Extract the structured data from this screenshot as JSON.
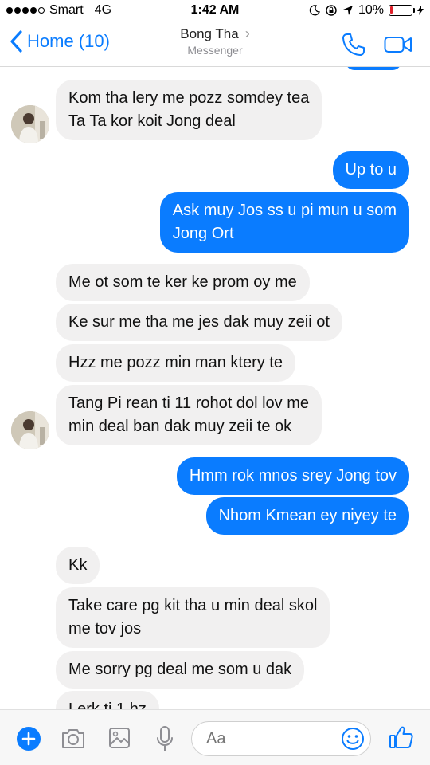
{
  "status_bar": {
    "carrier": "Smart",
    "network": "4G",
    "time": "1:42 AM",
    "battery": "10%",
    "battery_level": 0.1
  },
  "header": {
    "back_label": "Home (10)",
    "contact_name": "Bong Tha",
    "subtitle": "Messenger"
  },
  "messages": [
    {
      "dir": "in",
      "lines": [
        "Kom tha lery me pozz somdey tea",
        "Ta Ta kor koit Jong deal"
      ]
    },
    {
      "dir": "out",
      "lines": [
        "Up to u"
      ]
    },
    {
      "dir": "out",
      "lines": [
        "Ask muy Jos ss u pi mun u som",
        "Jong Ort"
      ]
    },
    {
      "dir": "in",
      "lines": [
        "Me ot som te ker ke prom oy me"
      ]
    },
    {
      "dir": "in",
      "lines": [
        "Ke sur me tha me jes dak muy zeii ot"
      ]
    },
    {
      "dir": "in",
      "lines": [
        "Hzz me pozz min man ktery te"
      ]
    },
    {
      "dir": "in",
      "lines": [
        "Tang Pi rean ti 11 rohot dol lov me",
        "min deal ban dak muy zeii te ok"
      ]
    },
    {
      "dir": "out",
      "lines": [
        "Hmm rok mnos srey Jong tov"
      ]
    },
    {
      "dir": "out",
      "lines": [
        "Nhom Kmean ey niyey te"
      ]
    },
    {
      "dir": "in",
      "lines": [
        "Kk"
      ]
    },
    {
      "dir": "in",
      "lines": [
        "Take care pg kit tha u min deal skol",
        "me tov jos"
      ]
    },
    {
      "dir": "in",
      "lines": [
        "Me sorry pg deal me som u dak"
      ]
    },
    {
      "dir": "in",
      "lines": [
        "Lerk ti 1 hz"
      ]
    }
  ],
  "composer": {
    "placeholder": "Aa"
  },
  "colors": {
    "accent": "#0a7cff",
    "incoming_bubble": "#f1f0f0",
    "outgoing_text": "#ffffff"
  }
}
